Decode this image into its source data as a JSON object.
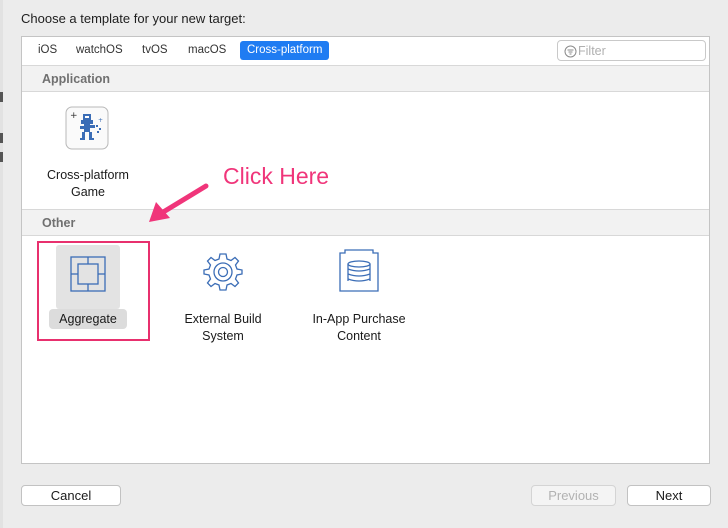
{
  "dialog": {
    "title": "Choose a template for your new target:"
  },
  "platform_tabs": [
    {
      "label": "iOS",
      "selected": false
    },
    {
      "label": "watchOS",
      "selected": false
    },
    {
      "label": "tvOS",
      "selected": false
    },
    {
      "label": "macOS",
      "selected": false
    },
    {
      "label": "Cross-platform",
      "selected": true
    }
  ],
  "filter": {
    "placeholder": "Filter",
    "value": "",
    "icon": "filter-icon"
  },
  "sections": [
    {
      "title": "Application",
      "templates": [
        {
          "label_line1": "Cross-platform",
          "label_line2": "Game",
          "icon": "game-sprite-icon",
          "selected": false
        }
      ]
    },
    {
      "title": "Other",
      "templates": [
        {
          "label_line1": "Aggregate",
          "label_line2": "",
          "icon": "aggregate-icon",
          "selected": true
        },
        {
          "label_line1": "External Build",
          "label_line2": "System",
          "icon": "gear-icon",
          "selected": false
        },
        {
          "label_line1": "In-App Purchase",
          "label_line2": "Content",
          "icon": "in-app-purchase-icon",
          "selected": false
        }
      ]
    }
  ],
  "annotation": {
    "text": "Click Here",
    "color": "#f0357a"
  },
  "buttons": {
    "cancel": "Cancel",
    "previous": "Previous",
    "next": "Next"
  },
  "colors": {
    "accent": "#1f7cf2",
    "highlight": "#e8306e",
    "icon_blue": "#3b6db6"
  }
}
